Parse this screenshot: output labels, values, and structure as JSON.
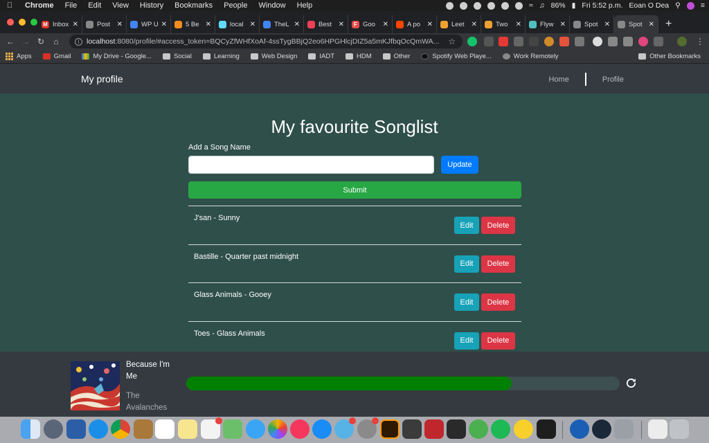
{
  "menubar": {
    "items": [
      "Chrome",
      "File",
      "Edit",
      "View",
      "History",
      "Bookmarks",
      "People",
      "Window",
      "Help"
    ],
    "battery": "86%",
    "clock": "Fri 5:52 p.m.",
    "user": "Eoan O Dea"
  },
  "tabs": [
    {
      "label": "Inbox",
      "icon": "gmail-icon",
      "color": "#d93025",
      "glyph": "M"
    },
    {
      "label": "Post",
      "icon": "globe-icon",
      "color": "#888888",
      "glyph": ""
    },
    {
      "label": "WP U",
      "icon": "chrome-icon",
      "color": "#4285f4",
      "glyph": ""
    },
    {
      "label": "5 Be",
      "icon": "doc-icon",
      "color": "#f28b20",
      "glyph": ""
    },
    {
      "label": "local",
      "icon": "react-icon",
      "color": "#61dafb",
      "glyph": ""
    },
    {
      "label": "TheL",
      "icon": "docs-icon",
      "color": "#4285f4",
      "glyph": ""
    },
    {
      "label": "Best",
      "icon": "pocket-icon",
      "color": "#ef4056",
      "glyph": ""
    },
    {
      "label": "Goo",
      "icon": "f-icon",
      "color": "#e44b4b",
      "glyph": "F"
    },
    {
      "label": "A po",
      "icon": "reddit-icon",
      "color": "#ff4500",
      "glyph": ""
    },
    {
      "label": "Leet",
      "icon": "leetcode-icon",
      "color": "#f0a030",
      "glyph": ""
    },
    {
      "label": "Two",
      "icon": "leetcode-icon",
      "color": "#f0a030",
      "glyph": ""
    },
    {
      "label": "Flyw",
      "icon": "flywheel-icon",
      "color": "#50c0c0",
      "glyph": ""
    },
    {
      "label": "Spot",
      "icon": "globe-icon",
      "color": "#888888",
      "glyph": ""
    },
    {
      "label": "Spot",
      "icon": "globe-icon",
      "color": "#888888",
      "glyph": ""
    }
  ],
  "active_tab_index": 13,
  "url": {
    "host": "localhost",
    "rest": ":8080/profile/#access_token=BQCyZfWHfXoAf-4ssTygBBjQ2eo6HPGHlcjDIZ5a5mKJfbqOcQmWA..."
  },
  "bookmarks": [
    {
      "label": "Apps",
      "icon": "apps-icon"
    },
    {
      "label": "Gmail",
      "icon": "gmail-icon"
    },
    {
      "label": "My Drive - Google...",
      "icon": "drive-icon"
    },
    {
      "label": "Social",
      "icon": "folder-icon"
    },
    {
      "label": "Learning",
      "icon": "folder-icon"
    },
    {
      "label": "Web Design",
      "icon": "folder-icon"
    },
    {
      "label": "IADT",
      "icon": "folder-icon"
    },
    {
      "label": "HDM",
      "icon": "folder-icon"
    },
    {
      "label": "Other",
      "icon": "folder-icon"
    },
    {
      "label": "Spotify Web Playe...",
      "icon": "spotify-icon"
    },
    {
      "label": "Work Remotely",
      "icon": "globe-icon"
    }
  ],
  "other_bookmarks": "Other Bookmarks",
  "app": {
    "brand": "My profile",
    "nav": [
      "Home",
      "Profile"
    ],
    "heading": "My favourite Songlist",
    "field_label": "Add a Song Name",
    "input_value": "",
    "update_label": "Update",
    "submit_label": "Submit",
    "edit_label": "Edit",
    "delete_label": "Delete",
    "songs": [
      "J'san - Sunny",
      "Bastille - Quarter past midnight",
      "Glass Animals - Gooey",
      "Toes - Glass Animals"
    ]
  },
  "player": {
    "track": "Because I'm Me",
    "artist": "The Avalanches",
    "progress": 0.75,
    "colors": {
      "fill": "#008000",
      "track": "#3e4f52"
    }
  },
  "colors": {
    "page_bg": "#2f4f4a",
    "navbar": "#343a40",
    "primary": "#007bff",
    "success": "#28a745",
    "info": "#17a2b8",
    "danger": "#dc3545"
  }
}
